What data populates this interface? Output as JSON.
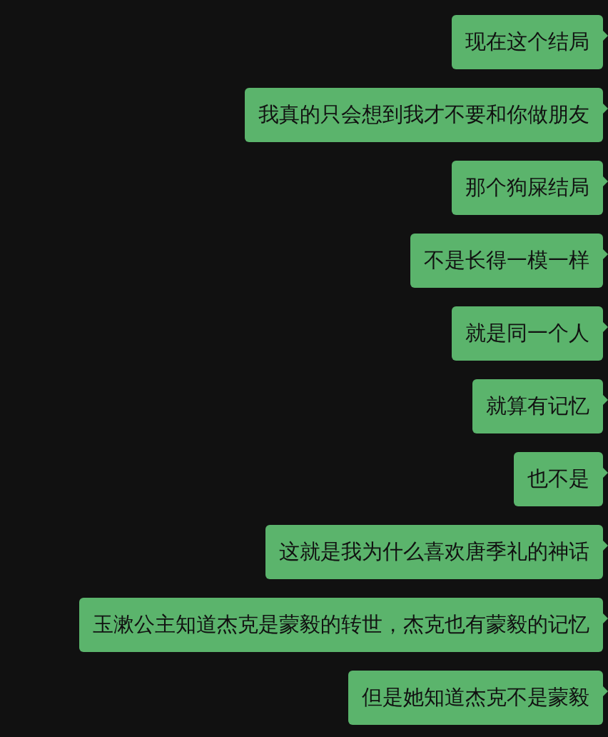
{
  "messages": [
    {
      "text": "现在这个结局"
    },
    {
      "text": "我真的只会想到我才不要和你做朋友"
    },
    {
      "text": "那个狗屎结局"
    },
    {
      "text": "不是长得一模一样"
    },
    {
      "text": "就是同一个人"
    },
    {
      "text": "就算有记忆"
    },
    {
      "text": "也不是"
    },
    {
      "text": "这就是我为什么喜欢唐季礼的神话"
    },
    {
      "text": "玉漱公主知道杰克是蒙毅的转世，杰克也有蒙毅的记忆"
    },
    {
      "text": "但是她知道杰克不是蒙毅"
    }
  ]
}
